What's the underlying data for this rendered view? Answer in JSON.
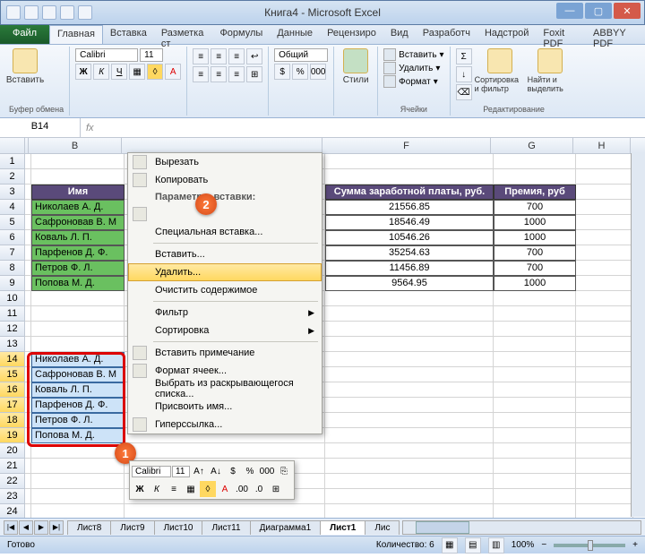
{
  "window": {
    "title": "Книга4 - Microsoft Excel"
  },
  "ribbon": {
    "file": "Файл",
    "tabs": [
      "Главная",
      "Вставка",
      "Разметка ст",
      "Формулы",
      "Данные",
      "Рецензиро",
      "Вид",
      "Разработч",
      "Надстрой",
      "Foxit PDF",
      "ABBYY PDF"
    ],
    "active_tab": "Главная",
    "paste": "Вставить",
    "clipboard_label": "Буфер обмена",
    "font_name": "Calibri",
    "font_size": "11",
    "number_format": "Общий",
    "styles": "Стили",
    "cells_insert": "Вставить",
    "cells_delete": "Удалить",
    "cells_format": "Формат",
    "cells_label": "Ячейки",
    "sort_filter": "Сортировка и фильтр",
    "find_select": "Найти и выделить",
    "editing_label": "Редактирование"
  },
  "namebox": "B14",
  "columns": {
    "B": "B",
    "F": "F",
    "G": "G",
    "H": "H"
  },
  "table": {
    "header_name": "Имя",
    "header_sum": "Сумма заработной платы, руб.",
    "header_bonus": "Премия, руб",
    "rows": [
      {
        "name": "Николаев А. Д.",
        "sum": "21556.85",
        "bonus": "700"
      },
      {
        "name": "Сафроновав В. М",
        "sum": "18546.49",
        "bonus": "1000"
      },
      {
        "name": "Коваль Л. П.",
        "sum": "10546.26",
        "bonus": "1000"
      },
      {
        "name": "Парфенов Д. Ф.",
        "sum": "35254.63",
        "bonus": "700"
      },
      {
        "name": "Петров Ф. Л.",
        "sum": "11456.89",
        "bonus": "700"
      },
      {
        "name": "Попова М. Д.",
        "sum": "9564.95",
        "bonus": "1000"
      }
    ],
    "dup_rows": [
      {
        "name": "Николаев А. Д."
      },
      {
        "name": "Сафроновав В. М"
      },
      {
        "name": "Коваль Л. П."
      },
      {
        "name": "Парфенов Д. Ф."
      },
      {
        "name": "Петров Ф. Л."
      },
      {
        "name": "Попова М. Д."
      }
    ]
  },
  "context_menu": {
    "cut": "Вырезать",
    "copy": "Копировать",
    "paste_options": "Параметры вставки:",
    "paste_special": "Специальная вставка...",
    "insert": "Вставить...",
    "delete": "Удалить...",
    "clear_contents": "Очистить содержимое",
    "filter": "Фильтр",
    "sort": "Сортировка",
    "insert_comment": "Вставить примечание",
    "format_cells": "Формат ячеек...",
    "pick_from_list": "Выбрать из раскрывающегося списка...",
    "define_name": "Присвоить имя...",
    "hyperlink": "Гиперссылка..."
  },
  "mini_toolbar": {
    "font": "Calibri",
    "size": "11"
  },
  "callouts": {
    "one": "1",
    "two": "2"
  },
  "sheet_tabs": [
    "Лист8",
    "Лист9",
    "Лист10",
    "Лист11",
    "Диаграмма1",
    "Лист1",
    "Лис"
  ],
  "active_sheet": "Лист1",
  "statusbar": {
    "ready": "Готово",
    "count": "Количество: 6",
    "zoom": "100%"
  }
}
